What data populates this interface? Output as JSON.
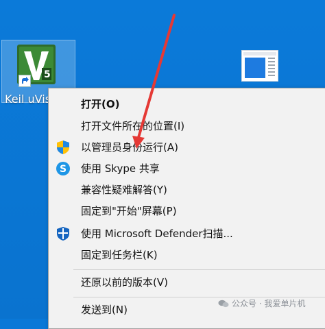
{
  "desktop": {
    "icon_label": "Keil uVis"
  },
  "context_menu": {
    "items": [
      {
        "label": "打开(O)",
        "bold": true
      },
      {
        "label": "打开文件所在的位置(I)"
      },
      {
        "label": "以管理员身份运行(A)",
        "icon": "shield-icon"
      },
      {
        "label": "使用 Skype 共享",
        "icon": "skype-icon"
      },
      {
        "label": "兼容性疑难解答(Y)"
      },
      {
        "label": "固定到\"开始\"屏幕(P)"
      },
      {
        "label": "使用 Microsoft Defender扫描...",
        "icon": "defender-icon"
      },
      {
        "label": "固定到任务栏(K)"
      },
      {
        "label": "还原以前的版本(V)"
      },
      {
        "label": "发送到(N)"
      }
    ]
  },
  "watermark": {
    "text": "公众号 · 我爱单片机"
  },
  "colors": {
    "desktop": "#0a78d7",
    "menu_bg": "#f2f2f2",
    "arrow": "#e53935",
    "keil_green": "#2e7d32"
  }
}
